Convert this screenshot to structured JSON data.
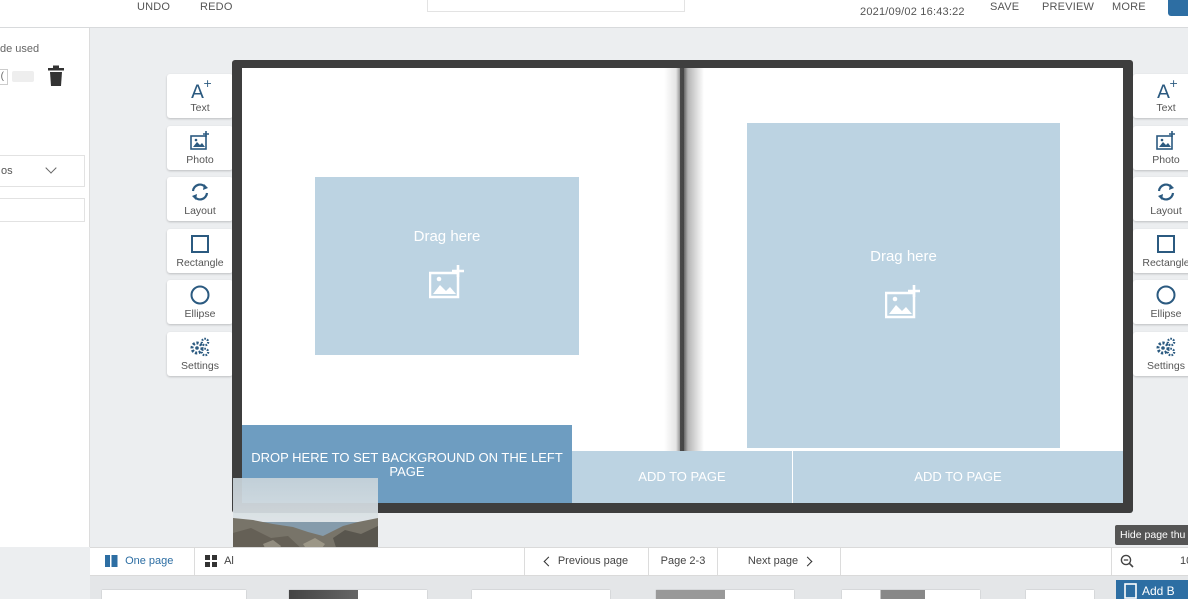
{
  "topbar": {
    "undo_label": "UNDO",
    "redo_label": "REDO",
    "timestamp": "2021/09/02 16:43:22",
    "save_label": "SAVE",
    "preview_label": "PREVIEW",
    "more_label": "MORE"
  },
  "left_panel": {
    "used_text": "de used",
    "box_value": "(",
    "select_value": "os"
  },
  "tools": [
    {
      "label": "Text",
      "icon": "text-add-icon"
    },
    {
      "label": "Photo",
      "icon": "photo-add-icon"
    },
    {
      "label": "Layout",
      "icon": "layout-refresh-icon"
    },
    {
      "label": "Rectangle",
      "icon": "rectangle-icon"
    },
    {
      "label": "Ellipse",
      "icon": "ellipse-icon"
    },
    {
      "label": "Settings",
      "icon": "settings-gears-icon"
    }
  ],
  "spread": {
    "left_slot_text": "Drag here",
    "right_slot_text": "Drag here",
    "drop_background_left": "DROP HERE TO SET BACKGROUND ON THE LEFT PAGE",
    "add_to_page_1": "ADD TO PAGE",
    "add_to_page_2": "ADD TO PAGE",
    "slot_color": "#bcd3e2",
    "drop_color": "#6e9dc1"
  },
  "bottombar": {
    "one_page_label": "One page",
    "all_label": "Al",
    "previous_label": "Previous page",
    "page_indicator": "Page 2-3",
    "next_label": "Next page",
    "zoom_value": "10"
  },
  "tooltip": "Hide page thu",
  "add_button_label": "Add B",
  "accent_color": "#2d6ea3"
}
